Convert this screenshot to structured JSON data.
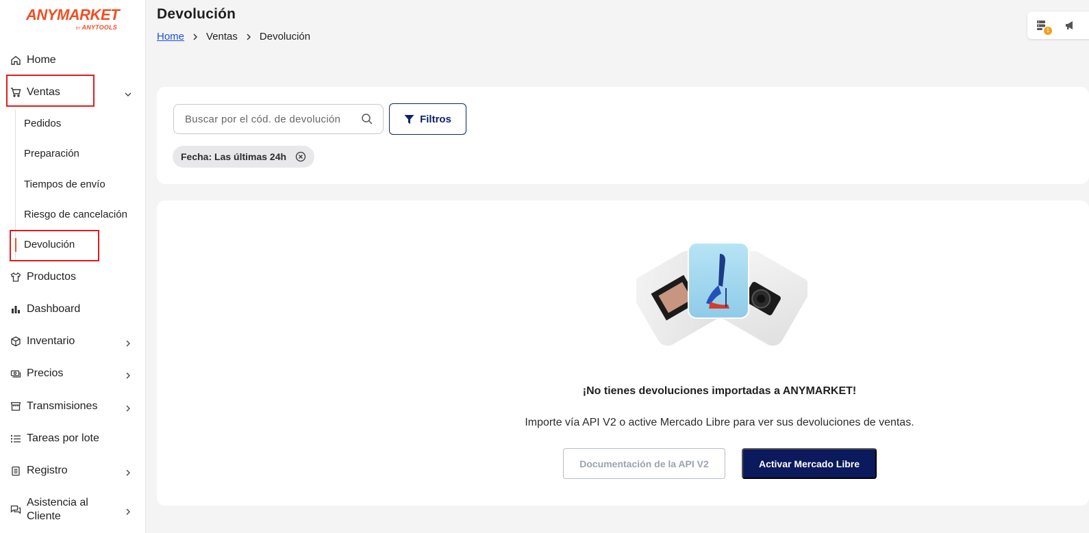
{
  "brand": {
    "name": "ANYMARKET",
    "by": "BY",
    "sub": "ANYTOOLS"
  },
  "colors": {
    "accent": "#f04e23",
    "navy": "#0b1a5c",
    "link": "#1d4ed8",
    "highlight": "#e01b1b"
  },
  "sidebar": {
    "items": [
      {
        "label": "Home",
        "icon": "home-icon"
      },
      {
        "label": "Ventas",
        "icon": "cart-icon",
        "expanded": true
      },
      {
        "label": "Productos",
        "icon": "shirt-icon"
      },
      {
        "label": "Dashboard",
        "icon": "bar-chart-icon"
      },
      {
        "label": "Inventario",
        "icon": "box-icon"
      },
      {
        "label": "Precios",
        "icon": "money-icon"
      },
      {
        "label": "Transmisiones",
        "icon": "store-icon"
      },
      {
        "label": "Tareas por lote",
        "icon": "list-icon"
      },
      {
        "label": "Registro",
        "icon": "clipboard-icon"
      },
      {
        "label": "Asistencia al",
        "label2": "Cliente",
        "icon": "chat-icon"
      }
    ],
    "ventas_sub": [
      "Pedidos",
      "Preparación",
      "Tiempos de envío",
      "Riesgo de cancelación",
      "Devolución"
    ]
  },
  "header": {
    "title": "Devolución",
    "breadcrumb": [
      "Home",
      "Ventas",
      "Devolución"
    ],
    "notification_count": "1"
  },
  "filters": {
    "search_placeholder": "Buscar por el cód. de devolución",
    "filter_label": "Filtros",
    "chip_label": "Fecha: Las últimas 24h"
  },
  "empty_state": {
    "title": "¡No tienes devoluciones importadas a ANYMARKET!",
    "description": "Importe vía API V2 o active Mercado Libre para ver sus devoluciones de ventas.",
    "doc_button": "Documentación de la API V2",
    "ml_button": "Activar Mercado Libre"
  }
}
